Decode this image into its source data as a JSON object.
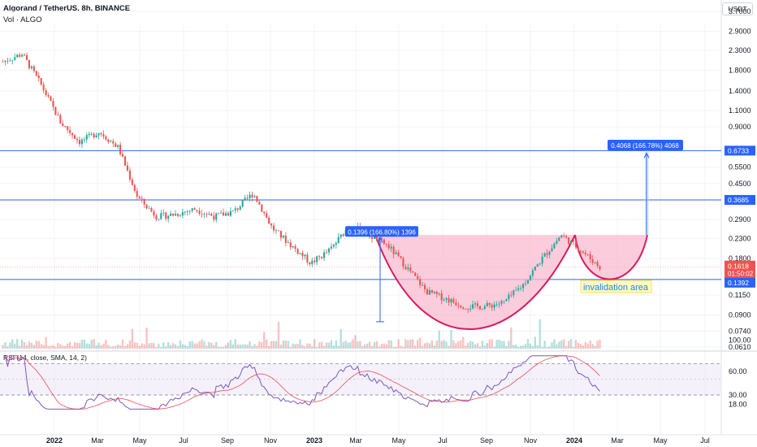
{
  "header": {
    "title": "Algorand / TetherUS, 8h, BINANCE",
    "volume_label": "Vol · ALGO",
    "currency_button": "USDT"
  },
  "colors": {
    "up": "#26a69a",
    "down": "#ef5350",
    "level_line": "#2962ff",
    "cup_fill": "#f8bbd0",
    "cup_stroke": "#d81b60",
    "rsi_line": "#7e57c2",
    "rsi_ma": "#f23645",
    "rsi_band": "#ede7f6"
  },
  "chart_data": [
    {
      "type": "candlestick",
      "scale": "log",
      "x_axis_labels": [
        "2022",
        "Mar",
        "May",
        "Jul",
        "Sep",
        "Nov",
        "2023",
        "Mar",
        "May",
        "Jul",
        "Sep",
        "Nov",
        "2024",
        "Mar",
        "May",
        "Jul"
      ],
      "y_axis_labels": [
        "3.7000",
        "2.9000",
        "2.3000",
        "1.8000",
        "1.4000",
        "1.1000",
        "0.9000",
        "0.5500",
        "0.4500",
        "0.2900",
        "0.2300",
        "0.1800",
        "0.1150",
        "0.0900",
        "0.0740",
        "0.0610"
      ],
      "price_path": [
        [
          "2022",
          2.0
        ],
        [
          "2022-01",
          2.2
        ],
        [
          "2022-02",
          1.5
        ],
        [
          "2022-03",
          0.95
        ],
        [
          "2022-04",
          0.75
        ],
        [
          "2022-04b",
          0.85
        ],
        [
          "May",
          0.7
        ],
        [
          "May-b",
          0.38
        ],
        [
          "Jun",
          0.3
        ],
        [
          "Jul",
          0.31
        ],
        [
          "Aug",
          0.33
        ],
        [
          "Sep",
          0.3
        ],
        [
          "Oct",
          0.32
        ],
        [
          "Nov",
          0.4
        ],
        [
          "Nov-b",
          0.26
        ],
        [
          "Dec",
          0.21
        ],
        [
          "Dec-b",
          0.17
        ],
        [
          "2023",
          0.2
        ],
        [
          "Feb",
          0.27
        ],
        [
          "Mar",
          0.24
        ],
        [
          "Apr",
          0.21
        ],
        [
          "May",
          0.16
        ],
        [
          "Jun",
          0.12
        ],
        [
          "Jul",
          0.11
        ],
        [
          "Aug",
          0.1
        ],
        [
          "Sep",
          0.1
        ],
        [
          "Oct",
          0.105
        ],
        [
          "Nov",
          0.13
        ],
        [
          "Dec",
          0.18
        ],
        [
          "Dec-b",
          0.24
        ],
        [
          "2024",
          0.2
        ],
        [
          "Feb",
          0.1618
        ]
      ],
      "price_labels": [
        {
          "value": "0.6733",
          "kind": "level"
        },
        {
          "value": "0.3685",
          "kind": "level"
        },
        {
          "value": "0.1618",
          "kind": "last"
        },
        {
          "value": "01:50:02",
          "kind": "countdown"
        },
        {
          "value": "0.1392",
          "kind": "level"
        }
      ],
      "horizontal_levels": [
        0.6733,
        0.3685,
        0.1392
      ],
      "measure_boxes": [
        {
          "text": "0.1396 (166.80%) 1396"
        },
        {
          "text": "0.4068 (166.78%) 4068"
        }
      ],
      "annotation": "invalidation area"
    },
    {
      "type": "line",
      "title": "RSI (14, close, SMA, 14, 2)",
      "y_axis_labels": [
        "100.00",
        "60.00",
        "30.00",
        "18.00"
      ],
      "bands": [
        70,
        30
      ]
    }
  ]
}
